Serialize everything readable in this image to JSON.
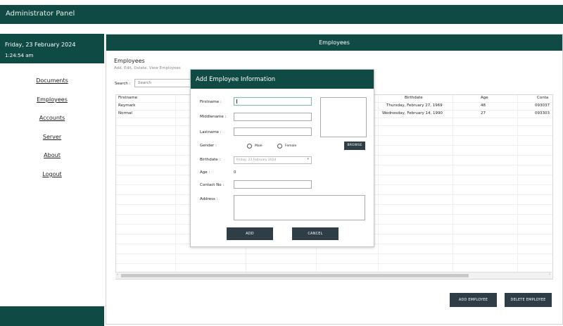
{
  "app": {
    "title": "Administrator Panel"
  },
  "sidebar": {
    "date": "Friday, 23 February 2024",
    "time": "1:24:54 am",
    "items": [
      {
        "label": "Documents"
      },
      {
        "label": "Employees"
      },
      {
        "label": "Accounts"
      },
      {
        "label": "Server"
      },
      {
        "label": "About"
      },
      {
        "label": "Logout"
      }
    ]
  },
  "main": {
    "header": "Employees",
    "title": "Employees",
    "subtitle": "Add, Edit, Delete, View Employees",
    "search_label": "Search :",
    "search_placeholder": "Search",
    "table": {
      "columns": [
        "Firstname",
        "Birthdate",
        "Age",
        "Conta"
      ],
      "rows": [
        [
          "Reymark",
          "Thursday, February 27, 1969",
          "48",
          "093037"
        ],
        [
          "Normal",
          "Wednesday, February 14, 1990",
          "27",
          "093303"
        ]
      ]
    },
    "scroll_left": "‹",
    "scroll_right": "›",
    "add_employee_label": "ADD EMPLOYEE",
    "delete_employee_label": "DELETE EMPLOYEE"
  },
  "modal": {
    "title": "Add Employee Information",
    "firstname_label": "Firstname :",
    "middlename_label": "Middlename :",
    "lastname_label": "Lastname :",
    "gender_label": "Gender :",
    "male_label": "Male",
    "female_label": "Female",
    "browse_label": "BROWSE",
    "birthdate_label": "Birthdate :",
    "birthdate_value": "Friday, 23 February 2024",
    "age_label": "Age :",
    "age_value": "0",
    "contact_label": "Contact No :",
    "address_label": "Address :",
    "add_label": "ADD",
    "cancel_label": "CANCEL"
  },
  "colors": {
    "primary": "#0f4a44",
    "button": "#2f3e46"
  }
}
